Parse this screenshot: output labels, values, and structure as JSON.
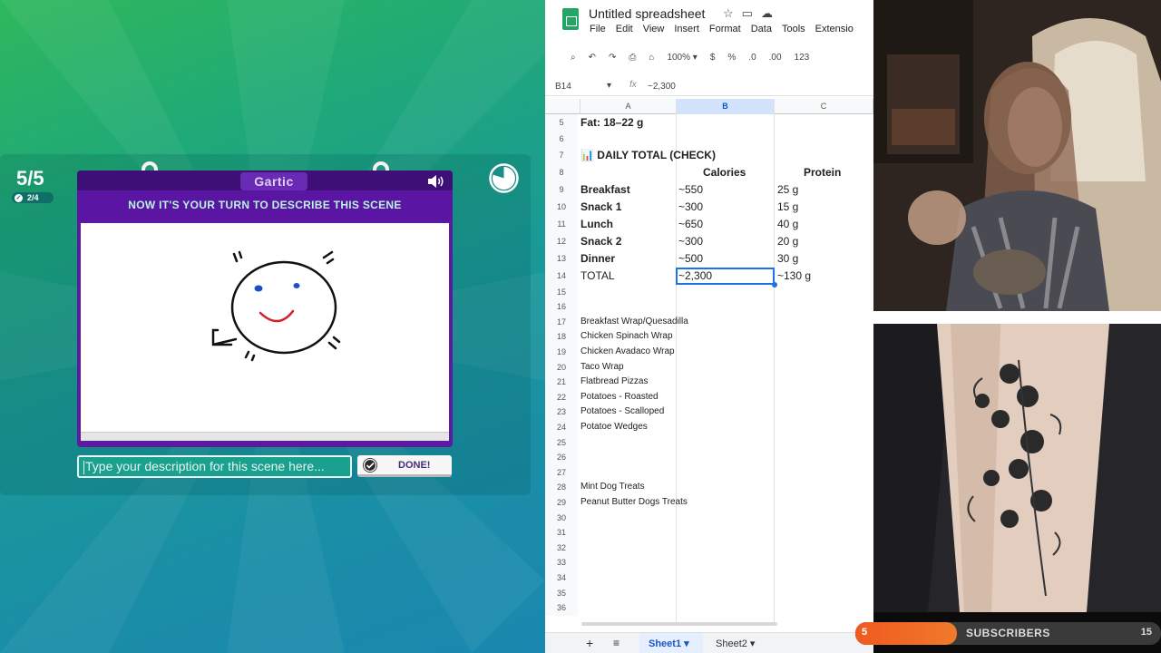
{
  "game": {
    "round": "5/5",
    "sub_round": "2/4",
    "logo": "Gartic",
    "instruction": "NOW IT'S YOUR TURN TO DESCRIBE THIS SCENE",
    "description_placeholder": "Type your description for this scene here...",
    "done_label": "DONE!",
    "colors": {
      "accent_purple": "#5a15a3",
      "instruction_text": "#b9f3e4"
    }
  },
  "sheet": {
    "title": "Untitled spreadsheet",
    "menu": [
      "File",
      "Edit",
      "View",
      "Insert",
      "Format",
      "Data",
      "Tools",
      "Extensio"
    ],
    "toolbar": {
      "zoom": "100%",
      "currency": "$",
      "percent": "%",
      "dec_decrease": ".0",
      "dec_increase": ".00",
      "number_format": "123"
    },
    "cell_ref": "B14",
    "formula_value": "~2,300",
    "columns": [
      "A",
      "B",
      "C"
    ],
    "rows": [
      {
        "n": "5",
        "a": "Fat: 18–22 g",
        "b": "",
        "c": "",
        "bold": true
      },
      {
        "n": "6",
        "a": "",
        "b": "",
        "c": ""
      },
      {
        "n": "7",
        "a": "📊 DAILY TOTAL (CHECK)",
        "b": "",
        "c": "",
        "bold": true
      },
      {
        "n": "8",
        "a": "",
        "b": "Calories",
        "c": "Protein",
        "header": true
      },
      {
        "n": "9",
        "a": "Breakfast",
        "b": "~550",
        "c": "25 g",
        "bold": true
      },
      {
        "n": "10",
        "a": "Snack 1",
        "b": "~300",
        "c": "15 g",
        "bold": true
      },
      {
        "n": "11",
        "a": "Lunch",
        "b": "~650",
        "c": "40 g",
        "bold": true
      },
      {
        "n": "12",
        "a": "Snack 2",
        "b": "~300",
        "c": "20 g",
        "bold": true
      },
      {
        "n": "13",
        "a": "Dinner",
        "b": "~500",
        "c": "30 g",
        "bold": true
      },
      {
        "n": "14",
        "a": "TOTAL",
        "b": "~2,300",
        "c": "~130 g",
        "total": true
      },
      {
        "n": "15",
        "a": "",
        "b": "",
        "c": ""
      },
      {
        "n": "16",
        "a": "",
        "b": "",
        "c": ""
      },
      {
        "n": "17",
        "a": "Breakfast Wrap/Quesadilla",
        "b": "",
        "c": ""
      },
      {
        "n": "18",
        "a": "Chicken Spinach Wrap",
        "b": "",
        "c": ""
      },
      {
        "n": "19",
        "a": "Chicken Avadaco Wrap",
        "b": "",
        "c": ""
      },
      {
        "n": "20",
        "a": "Taco Wrap",
        "b": "",
        "c": ""
      },
      {
        "n": "21",
        "a": "Flatbread Pizzas",
        "b": "",
        "c": ""
      },
      {
        "n": "22",
        "a": "Potatoes - Roasted",
        "b": "",
        "c": ""
      },
      {
        "n": "23",
        "a": "Potatoes - Scalloped",
        "b": "",
        "c": ""
      },
      {
        "n": "24",
        "a": "Potatoe Wedges",
        "b": "",
        "c": ""
      },
      {
        "n": "25",
        "a": "",
        "b": "",
        "c": ""
      },
      {
        "n": "26",
        "a": "",
        "b": "",
        "c": ""
      },
      {
        "n": "27",
        "a": "",
        "b": "",
        "c": ""
      },
      {
        "n": "28",
        "a": "Mint Dog Treats",
        "b": "",
        "c": ""
      },
      {
        "n": "29",
        "a": "Peanut Butter Dogs Treats",
        "b": "",
        "c": ""
      },
      {
        "n": "30",
        "a": "",
        "b": "",
        "c": ""
      },
      {
        "n": "31",
        "a": "",
        "b": "",
        "c": ""
      },
      {
        "n": "32",
        "a": "",
        "b": "",
        "c": ""
      },
      {
        "n": "33",
        "a": "",
        "b": "",
        "c": ""
      },
      {
        "n": "34",
        "a": "",
        "b": "",
        "c": ""
      },
      {
        "n": "35",
        "a": "",
        "b": "",
        "c": ""
      },
      {
        "n": "36",
        "a": "",
        "b": "",
        "c": ""
      }
    ],
    "tabs": [
      "Sheet1",
      "Sheet2"
    ],
    "active_tab": "Sheet1"
  },
  "overlay": {
    "subscribers_current": "5",
    "subscribers_label": "SUBSCRIBERS",
    "subscribers_goal": "15",
    "subscribers_fraction": 0.333
  }
}
